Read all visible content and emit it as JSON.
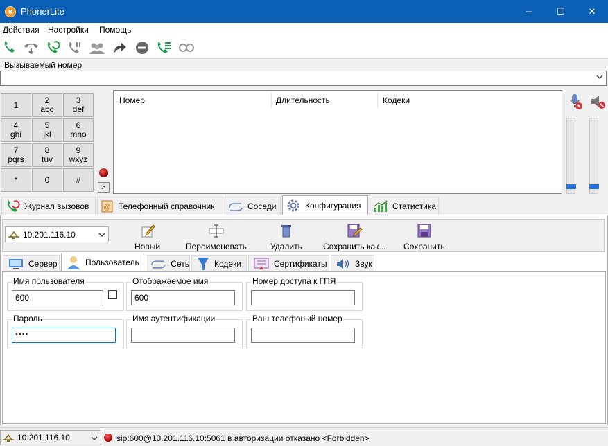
{
  "window": {
    "title": "PhonerLite",
    "controls": {
      "minimize": "─",
      "maximize": "☐",
      "close": "✕"
    }
  },
  "menu": [
    "Действия",
    "Настройки",
    "Помощь"
  ],
  "toolbar_icons": [
    "call-icon",
    "hold-icon",
    "redial-icon",
    "hangup-icon",
    "conference-icon",
    "transfer-icon",
    "stop-icon",
    "call-waiting-icon",
    "mute-icon"
  ],
  "dial": {
    "label": "Вызываемый номер",
    "value": ""
  },
  "keypad": [
    {
      "digit": "1",
      "letters": ""
    },
    {
      "digit": "2",
      "letters": "abc"
    },
    {
      "digit": "3",
      "letters": "def"
    },
    {
      "digit": "4",
      "letters": "ghi"
    },
    {
      "digit": "5",
      "letters": "jkl"
    },
    {
      "digit": "6",
      "letters": "mno"
    },
    {
      "digit": "7",
      "letters": "pqrs"
    },
    {
      "digit": "8",
      "letters": "tuv"
    },
    {
      "digit": "9",
      "letters": "wxyz"
    },
    {
      "digit": "*",
      "letters": ""
    },
    {
      "digit": "0",
      "letters": ""
    },
    {
      "digit": "#",
      "letters": ""
    }
  ],
  "expand_label": ">",
  "calls_table": {
    "columns": [
      "Номер",
      "Длительность",
      "Кодеки"
    ],
    "rows": []
  },
  "main_tabs": [
    {
      "label": "Журнал вызовов",
      "icon": "call-log-icon"
    },
    {
      "label": "Телефонный справочник",
      "icon": "phonebook-icon"
    },
    {
      "label": "Соседи",
      "icon": "neighbors-icon"
    },
    {
      "label": "Конфигурация",
      "icon": "gear-icon",
      "active": true
    },
    {
      "label": "Статистика",
      "icon": "statistics-icon"
    }
  ],
  "profile": {
    "selected": "10.201.116.10",
    "buttons": [
      "Новый",
      "Переименовать",
      "Удалить",
      "Сохранить как...",
      "Сохранить"
    ]
  },
  "sub_tabs": [
    {
      "label": "Сервер",
      "icon": "server-icon"
    },
    {
      "label": "Пользователь",
      "icon": "user-icon",
      "active": true
    },
    {
      "label": "Сеть",
      "icon": "network-icon"
    },
    {
      "label": "Кодеки",
      "icon": "codecs-icon"
    },
    {
      "label": "Сертификаты",
      "icon": "certificate-icon"
    },
    {
      "label": "Звук",
      "icon": "speaker-icon"
    }
  ],
  "user_form": {
    "username": {
      "label": "Имя пользователя",
      "value": "600",
      "checked": false
    },
    "display_name": {
      "label": "Отображаемое имя",
      "value": "600"
    },
    "access_number": {
      "label": "Номер доступа к ГПЯ",
      "value": ""
    },
    "password": {
      "label": "Пароль",
      "value": "••••"
    },
    "auth_name": {
      "label": "Имя аутентификации",
      "value": ""
    },
    "phone_number": {
      "label": "Ваш телефоный номер",
      "value": ""
    }
  },
  "status": {
    "profile": "10.201.116.10",
    "message": "sip:600@10.201.116.10:5061 в авторизации отказано <Forbidden>",
    "indicator_color": "#d40000"
  },
  "colors": {
    "titlebar": "#0b5fb5",
    "accent": "#1e6fd9"
  }
}
